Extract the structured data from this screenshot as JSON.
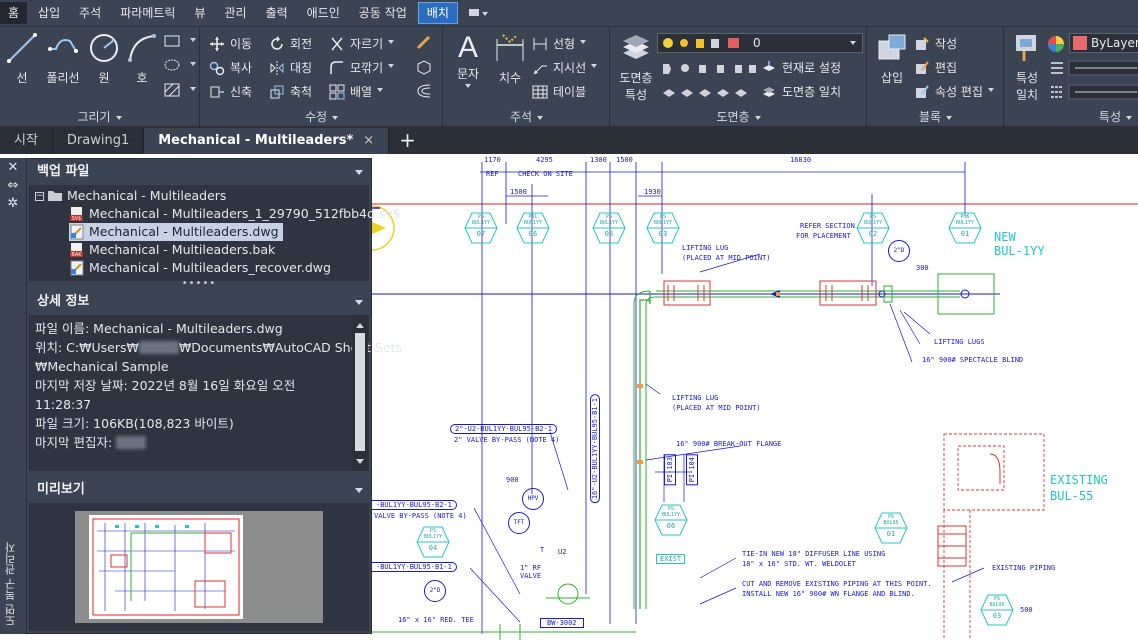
{
  "menu_tabs": [
    "홈",
    "삽입",
    "주석",
    "파라메트릭",
    "뷰",
    "관리",
    "출력",
    "애드인",
    "공동 작업",
    "배치"
  ],
  "ribbon": {
    "draw": {
      "title": "그리기",
      "line": "선",
      "polyline": "폴리선",
      "circle": "원",
      "arc": "호"
    },
    "modify": {
      "title": "수정",
      "move": "이동",
      "rotate": "회전",
      "trim": "자르기",
      "copy": "복사",
      "mirror": "대칭",
      "fillet": "모깎기",
      "stretch": "신축",
      "scale": "축척",
      "array": "배열"
    },
    "annotation": {
      "title": "주석",
      "text": "문자",
      "dimension": "치수",
      "linear": "선형",
      "leader": "지시선",
      "table": "테이블"
    },
    "layers": {
      "title": "도면층",
      "props": "도면층",
      "props2": "특성",
      "current_layer": "0",
      "make_current": "현재로 설정",
      "match": "도면층 일치"
    },
    "block": {
      "title": "블록",
      "insert": "삽입",
      "create": "작성",
      "edit": "편집",
      "edit_attr": "속성 편집"
    },
    "properties": {
      "title": "특성",
      "match": "특성",
      "match2": "일치",
      "bylayer": "ByLayer"
    }
  },
  "doc_tabs": {
    "start": "시작",
    "drawing1": "Drawing1",
    "active": "Mechanical - Multileaders*",
    "close": "×",
    "new": "+"
  },
  "side_strip": {
    "label": "도면 복구 관리자"
  },
  "palette": {
    "backup_header": "백업 파일",
    "root": "Mechanical - Multileaders",
    "files": [
      {
        "name": "Mechanical - Multileaders_1_29790_512fbb4d.sv$",
        "type": "SV$"
      },
      {
        "name": "Mechanical - Multileaders.dwg",
        "type": "DWG"
      },
      {
        "name": "Mechanical - Multileaders.bak",
        "type": "BAK"
      },
      {
        "name": "Mechanical - Multileaders_recover.dwg",
        "type": "DWG"
      }
    ],
    "grip": "•••••",
    "details_header": "상세 정보",
    "details": {
      "filename": "파일 이름: Mechanical - Multileaders.dwg",
      "location_prefix": "위치: C:₩Users₩",
      "location_rest": "₩Documents₩AutoCAD Sheet Sets",
      "location_line2": "₩Mechanical Sample",
      "saved": "마지막 저장 날짜: 2022년 8월 16일 화요일  오전",
      "saved_time": "11:28:37",
      "size": "파일 크기: 106KB(108,823 바이트)",
      "editor": "마지막 편집자: "
    },
    "preview_header": "미리보기"
  },
  "drawing": {
    "dims": [
      "1170",
      "4295",
      "1300",
      "1500",
      "16830",
      "1500",
      "1930",
      "300",
      "900",
      "U2",
      "T",
      "500"
    ],
    "notes": [
      "REF",
      "CHECK ON SITE",
      "REFER SECTION",
      "FOR PLACEMENT",
      "LIFTING LUG",
      "(PLACED AT MID POINT)",
      "LIFTING LUGS",
      "16\" 900# SPECTACLE BLIND",
      "LIFTING LUG",
      "(PLACED AT MID POINT)",
      "16\" 900# BREAK-OUT FLANGE",
      "2\"-U2-BUL1YY-BUL95-B2-1",
      "2\" VALVE BY-PASS (NOTE 4)",
      "-BUL1YY-BUL95-B2-1",
      "VALVE BY-PASS (NOTE 4)",
      "-BUL1YY-BUL95-B1-1",
      "TIE-IN NEW 18\" DIFFUSER LINE USING",
      "18\" x 16\" STD. WT. WELDOLET",
      "CUT AND REMOVE EXISTING PIPING AT THIS POINT.",
      "INSTALL NEW 16\" 900# WN FLANGE AND BLIND.",
      "EXISTING PIPING",
      "16\" x 16\" RED. TEE",
      "1\" RF VALVE",
      "16\"-U2-BUL1YY-BUL95-B1-1",
      "BW-3002"
    ],
    "new_label": [
      "NEW",
      "BUL-1YY"
    ],
    "existing_label": [
      "EXISTING",
      "BUL-55"
    ],
    "hex_tags": [
      {
        "t": "PS",
        "m": "BUL1YY",
        "n": "07"
      },
      {
        "t": "PIL",
        "m": "BUL1YY",
        "n": "06"
      },
      {
        "t": "PS",
        "m": "BUL1YY",
        "n": "05"
      },
      {
        "t": "PS",
        "m": "BUL1YY",
        "n": "03"
      },
      {
        "t": "PS",
        "m": "BUL1YY",
        "n": "02"
      },
      {
        "t": "PHK",
        "m": "BUL1YY",
        "n": "01"
      },
      {
        "t": "PS",
        "m": "BUL1YY",
        "n": "06"
      },
      {
        "t": "PS",
        "m": "BUL1YY",
        "n": "04"
      },
      {
        "t": "PS",
        "m": "BUL95",
        "n": "01"
      },
      {
        "t": "PS",
        "m": "BUL95",
        "n": "03"
      }
    ],
    "circles": [
      "2\"D",
      "HPV",
      "TFT",
      "2\"D"
    ],
    "tags": [
      "PI-103",
      "PI-104",
      "EXIST"
    ]
  }
}
